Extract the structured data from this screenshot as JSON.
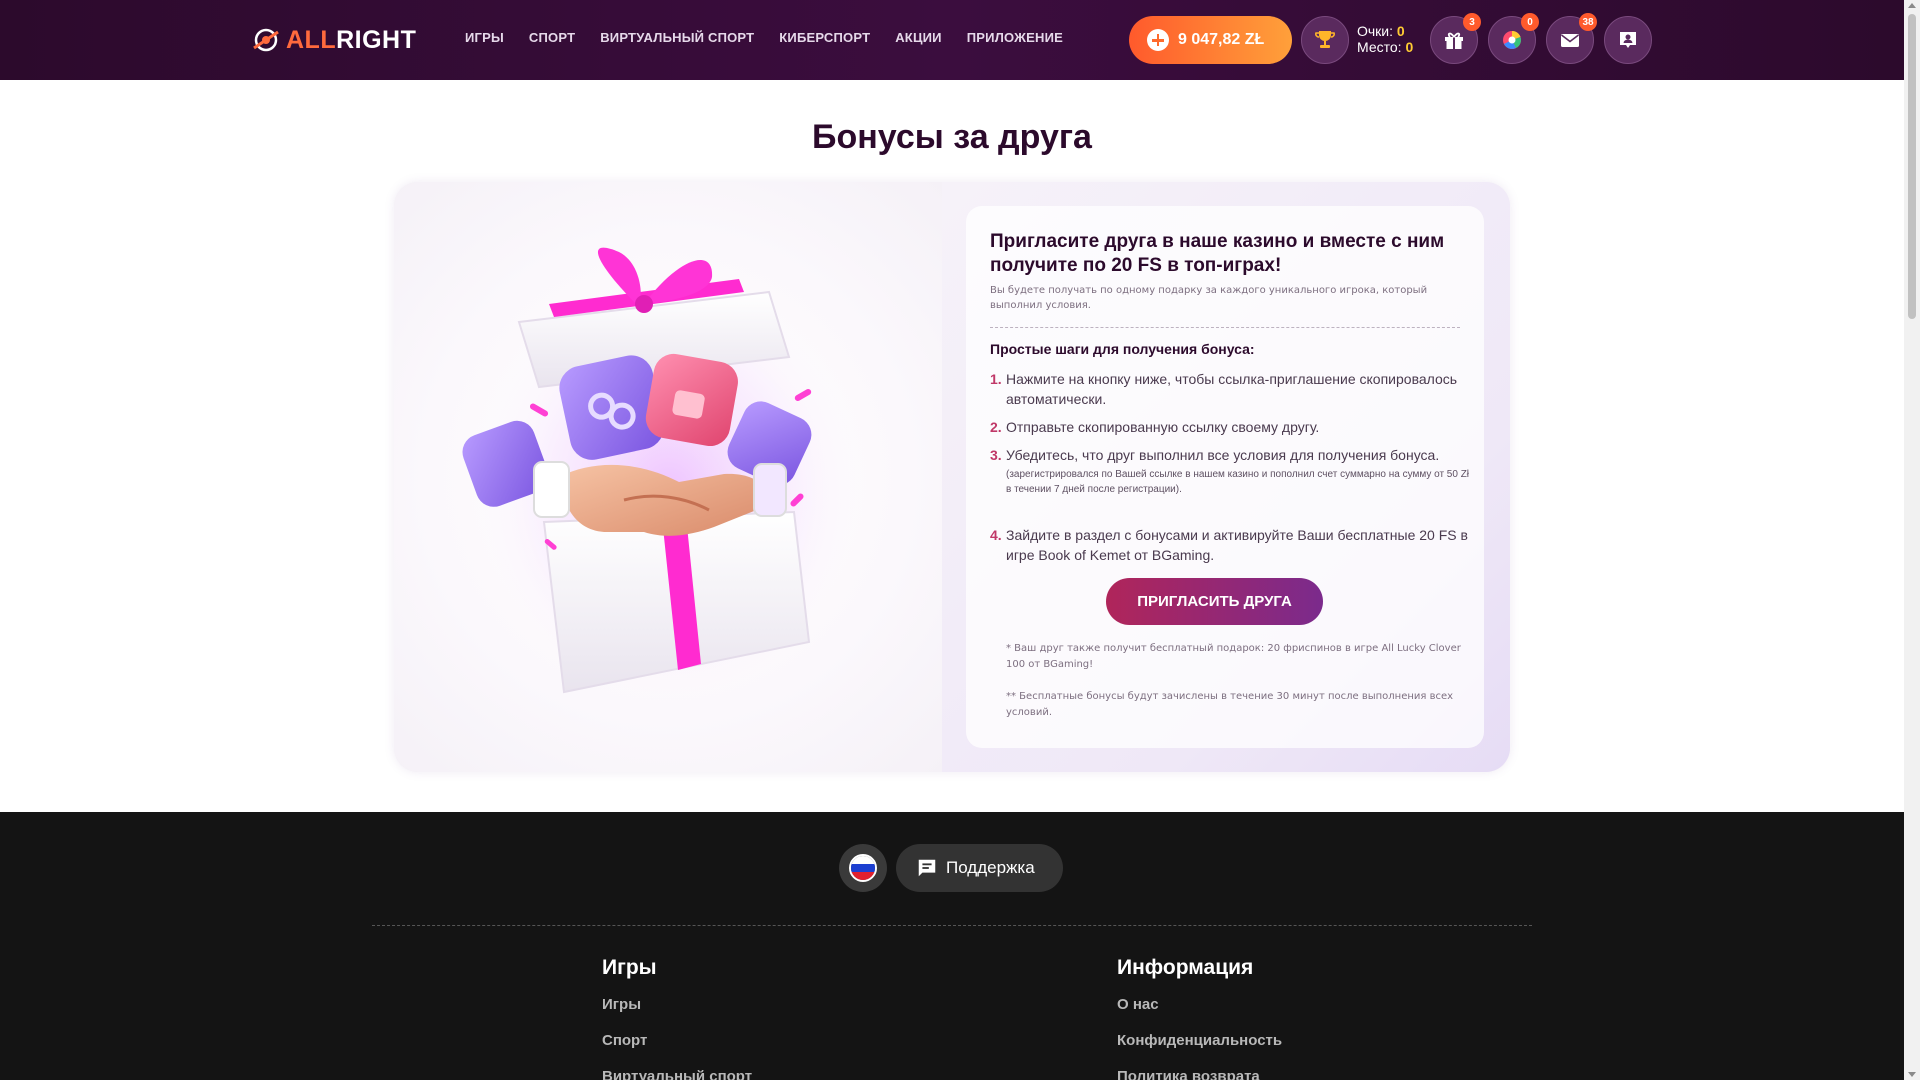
{
  "header": {
    "logo": {
      "part1": "ALL",
      "part2": "RIGHT"
    },
    "nav": [
      "ИГРЫ",
      "СПОРТ",
      "ВИРТУАЛЬНЫЙ СПОРТ",
      "КИБЕРСПОРТ",
      "АКЦИИ",
      "ПРИЛОЖЕНИЕ"
    ],
    "balance": "9 047,82 ZŁ",
    "score": {
      "points_label": "Очки:",
      "points_value": "0",
      "place_label": "Место:",
      "place_value": "0"
    },
    "badges": {
      "gifts": "3",
      "wheel": "0",
      "messages": "38"
    }
  },
  "page": {
    "title": "Бонусы за друга"
  },
  "invite": {
    "title": "Пригласите друга в наше казино и вместе с ним получите по 20 FS в топ-играх!",
    "subtitle": "Вы будете получать по одному подарку за каждого уникального игрока, который выполнил условия.",
    "steps_title": "Простые шаги для получения бонуса:",
    "steps": [
      {
        "num": "1.",
        "text": "Нажмите на кнопку ниже, чтобы ссылка-приглашение скопировалось автоматически.",
        "note": ""
      },
      {
        "num": "2.",
        "text": "Отправьте скопированную ссылку своему другу.",
        "note": ""
      },
      {
        "num": "3.",
        "text": "Убедитесь, что друг выполнил все условия для получения бонуса.",
        "note": "(зарегистрировался по Вашей ссылке в нашем казино и пополнил счет суммарно на сумму от 50 Zł в течении 7 дней после регистрации)."
      },
      {
        "num": "4.",
        "text": "Зайдите в раздел с бонусами и активируйте Ваши бесплатные 20 FS в игре Book of Kemet от BGaming.",
        "note": ""
      }
    ],
    "button": "ПРИГЛАСИТЬ ДРУГА",
    "note1": "* Ваш друг также получит бесплатный подарок: 20 фриспинов в игре All Lucky Clover 100 от BGaming!",
    "note2": "** Бесплатные бонусы будут зачислены в течение 30 минут после выполнения всех условий."
  },
  "footer": {
    "support": "Поддержка",
    "col1": {
      "title": "Игры",
      "links": [
        "Игры",
        "Спорт",
        "Виртуальный спорт"
      ]
    },
    "col2": {
      "title": "Информация",
      "links": [
        "О нас",
        "Конфиденциальность",
        "Политика возврата"
      ]
    }
  },
  "colors": {
    "header_bg": "#2c0a2c",
    "accent_orange": "#ff6a3d",
    "button": "#b0255a",
    "title": "#2c0a2c"
  },
  "icons": [
    "trophy-icon",
    "gift-icon",
    "wheel-icon",
    "mail-icon",
    "profile-icon",
    "chat-icon",
    "ru-flag-icon"
  ]
}
